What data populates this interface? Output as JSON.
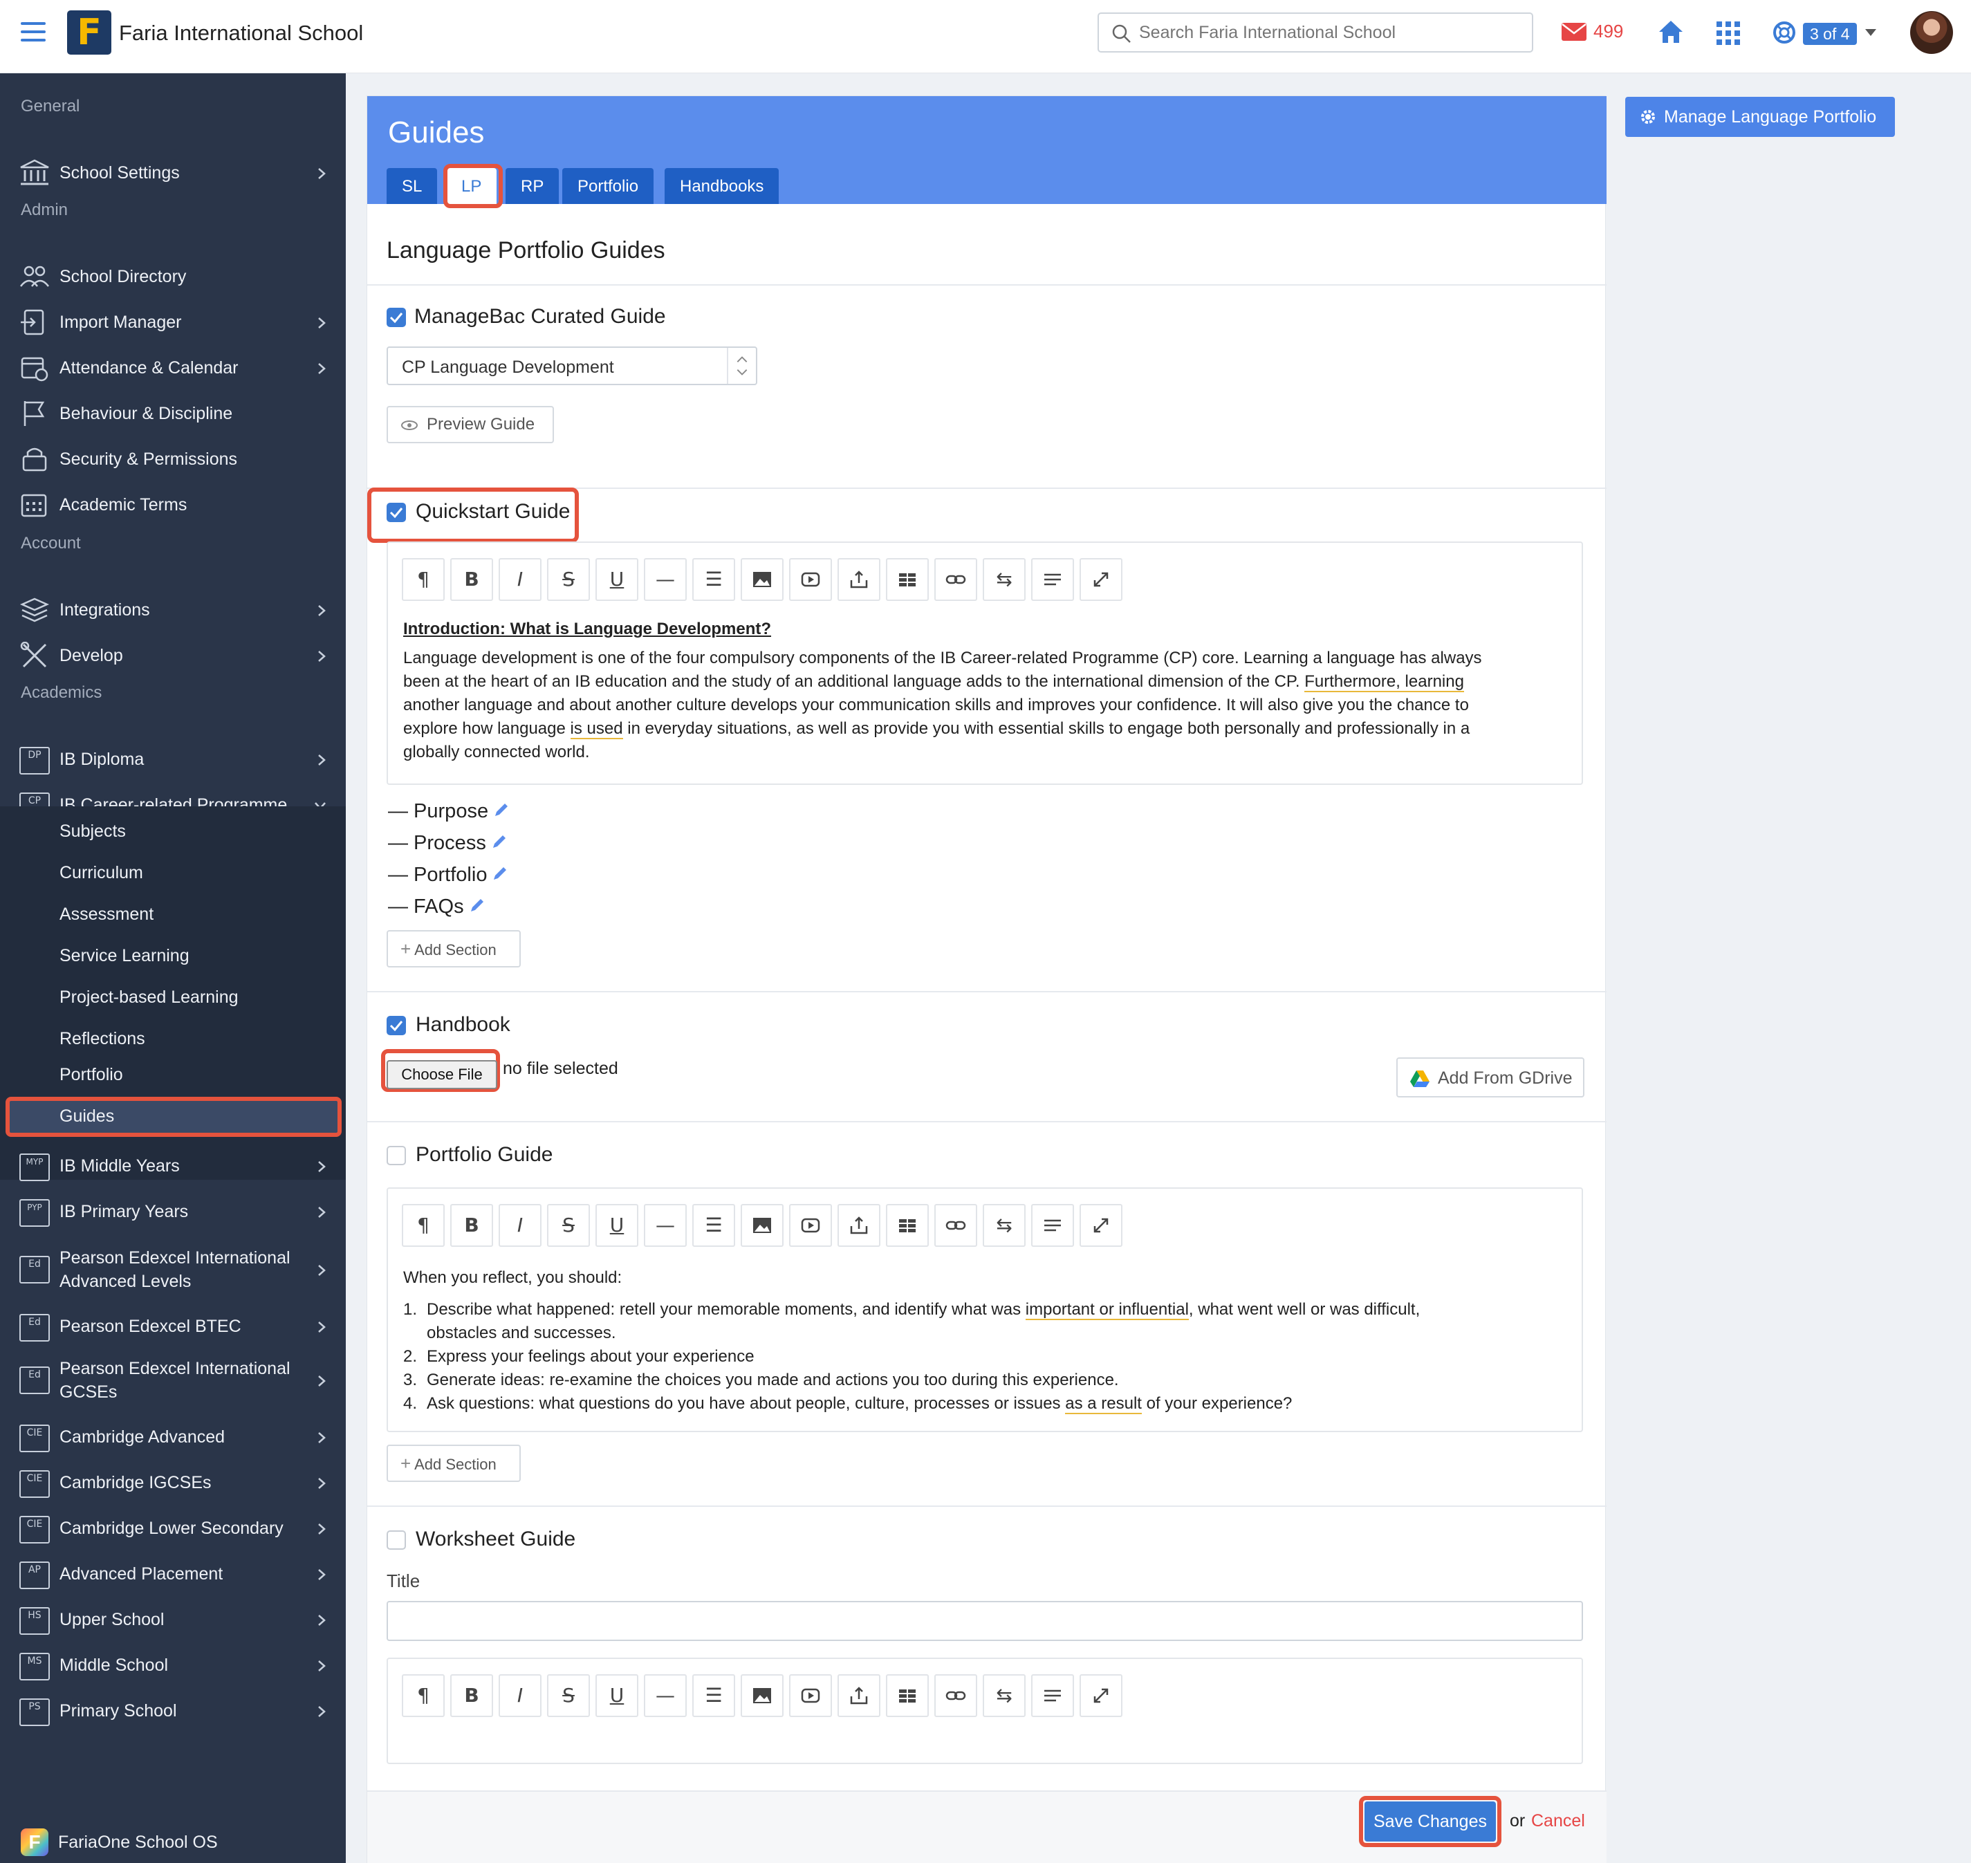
{
  "header": {
    "app_title": "Faria International School",
    "search_placeholder": "Search Faria International School",
    "mail_count": "499",
    "badge": "3 of 4"
  },
  "sidebar": {
    "headings": {
      "general": "General",
      "admin": "Admin",
      "account": "Account",
      "academics": "Academics"
    },
    "general_items": [
      {
        "label": "School Settings",
        "icon": "building-icon"
      }
    ],
    "admin_items": [
      {
        "label": "School Directory",
        "icon": "people-icon"
      },
      {
        "label": "Import Manager",
        "icon": "import-icon"
      },
      {
        "label": "Attendance & Calendar",
        "icon": "calendar-clock-icon"
      },
      {
        "label": "Behaviour & Discipline",
        "icon": "flag-icon"
      },
      {
        "label": "Security & Permissions",
        "icon": "lock-icon"
      },
      {
        "label": "Academic Terms",
        "icon": "calendar-icon"
      }
    ],
    "account_items": [
      {
        "label": "Integrations",
        "icon": "layers-icon"
      },
      {
        "label": "Develop",
        "icon": "tools-icon"
      }
    ],
    "academic_items": [
      {
        "label": "IB Diploma",
        "badge": "DP"
      },
      {
        "label": "IB Career-related Programme",
        "badge": "CP"
      }
    ],
    "cp_sub_items": [
      "Subjects",
      "Curriculum",
      "Assessment",
      "Service Learning",
      "Project-based Learning",
      "Reflections",
      "Portfolio",
      "Guides"
    ],
    "other_programmes": [
      {
        "label": "IB Middle Years",
        "badge": "MYP"
      },
      {
        "label": "IB Primary Years",
        "badge": "PYP"
      },
      {
        "label": "Pearson Edexcel International Advanced Levels",
        "line1": "Pearson Edexcel International",
        "line2": "Advanced Levels",
        "badge": "Ed"
      },
      {
        "label": "Pearson Edexcel BTEC",
        "badge": "Ed"
      },
      {
        "label": "Pearson Edexcel International GCSEs",
        "line1": "Pearson Edexcel International",
        "line2": "GCSEs",
        "badge": "Ed"
      },
      {
        "label": "Cambridge Advanced",
        "badge": "CIE"
      },
      {
        "label": "Cambridge IGCSEs",
        "badge": "CIE"
      },
      {
        "label": "Cambridge Lower Secondary",
        "badge": "CIE"
      },
      {
        "label": "Advanced Placement",
        "badge": "AP"
      },
      {
        "label": "Upper School",
        "badge": "HS"
      },
      {
        "label": "Middle School",
        "badge": "MS"
      },
      {
        "label": "Primary School",
        "badge": "PS"
      }
    ],
    "footer": "FariaOne School OS"
  },
  "panel": {
    "title": "Guides",
    "tabs": [
      "SL",
      "LP",
      "RP",
      "Portfolio",
      "Handbooks"
    ],
    "active_tab": "LP",
    "section_title": "Language Portfolio Guides",
    "curated": {
      "label": "ManageBac Curated Guide",
      "checked": true,
      "select_value": "CP Language Development",
      "preview_label": "Preview Guide"
    },
    "quickstart": {
      "label": "Quickstart Guide",
      "checked": true,
      "heading": "Introduction: What is Language Development?",
      "body_lines": [
        "Language development is one of the four compulsory components of the IB Career-related Programme (CP) core. Learning a language has always",
        "been at the heart of an IB education and the study of an additional language adds to the international dimension of the CP.",
        "Furthermore, learning",
        "another language and about another culture develops your communication skills and improves your confidence. It will also give you the chance to",
        "explore how language",
        "is used",
        "in everyday situations, as well as provide you with essential skills to engage both personally and professionally in a",
        "globally connected world."
      ],
      "sections": [
        "— Purpose",
        "— Process",
        "— Portfolio",
        "— FAQs"
      ],
      "add_section": "Add Section"
    },
    "handbook": {
      "label": "Handbook",
      "checked": true,
      "choose_file": "Choose File",
      "no_file": "no file selected",
      "gdrive": "Add From GDrive"
    },
    "portfolio_guide": {
      "label": "Portfolio Guide",
      "checked": false,
      "intro": "When you reflect, you should:",
      "items": [
        {
          "n": "1.",
          "a": "Describe what happened: retell your memorable moments, and identify what was ",
          "u": "important or influential",
          "b": ", what went well or was difficult,",
          "c": "obstacles and successes."
        },
        {
          "n": "2.",
          "a": "Express your feelings about your experience"
        },
        {
          "n": "3.",
          "a": "Generate ideas: re-examine the choices you made and actions you too during this experience."
        },
        {
          "n": "4.",
          "a": "Ask questions: what questions do you have about people, culture, processes or issues ",
          "u": "as a result",
          "b": " of your experience?"
        }
      ],
      "add_section": "Add Section"
    },
    "worksheet": {
      "label": "Worksheet Guide",
      "checked": false,
      "title_label": "Title",
      "title_value": ""
    },
    "save": "Save Changes",
    "or": "or",
    "cancel": "Cancel"
  },
  "manage_button": "Manage Language Portfolio",
  "toolbar_buttons": [
    "paragraph",
    "bold",
    "italic",
    "strikethrough",
    "underline",
    "horizontal-rule",
    "list",
    "image",
    "video",
    "upload",
    "table",
    "link",
    "swap",
    "align",
    "fullscreen"
  ],
  "colors": {
    "accent": "#3a7bd5",
    "header_blue": "#5b8dec",
    "sidebar": "#2a3549",
    "highlight": "#e5533d",
    "danger": "#e64545"
  }
}
